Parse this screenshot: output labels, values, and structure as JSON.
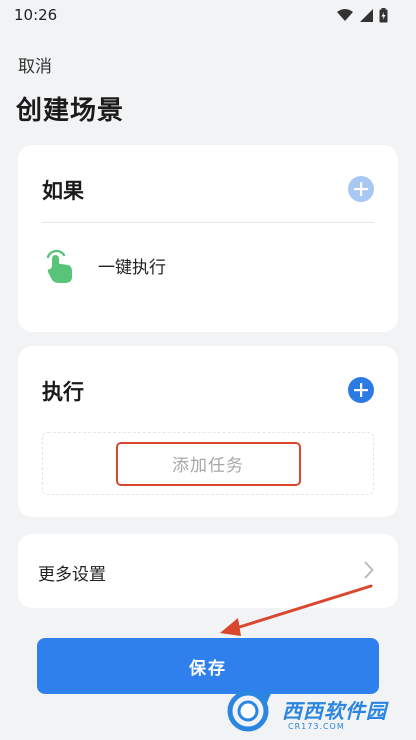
{
  "status_bar": {
    "time": "10:26"
  },
  "header": {
    "cancel_label": "取消",
    "title": "创建场景"
  },
  "if_card": {
    "title": "如果",
    "trigger_label": "一键执行"
  },
  "do_card": {
    "title": "执行",
    "add_task_label": "添加任务"
  },
  "more_card": {
    "label": "更多设置"
  },
  "footer": {
    "save_label": "保存"
  },
  "watermark": {
    "name": "西西软件园",
    "site": "CR173.COM"
  },
  "colors": {
    "accent": "#2f80ec",
    "highlight": "#d9472e",
    "trigger_icon": "#58c47a"
  }
}
